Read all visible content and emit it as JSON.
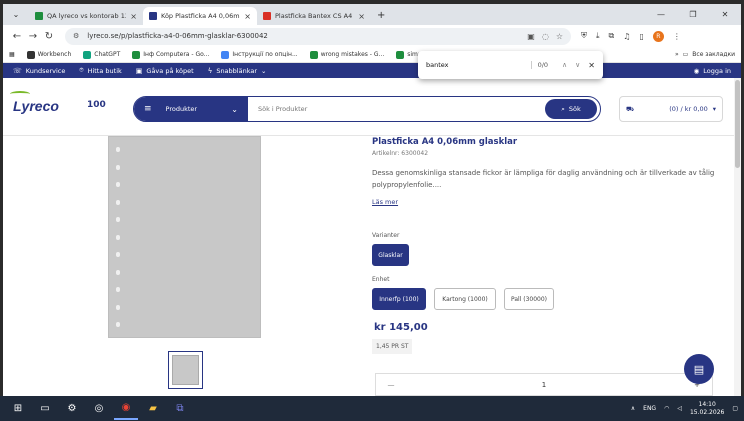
{
  "browser": {
    "tabs": [
      {
        "label": "QA lyreco vs kontorab 1388.xlsx",
        "favicon_color": "#1e8e3e",
        "active": false
      },
      {
        "label": "Köp Plastficka A4 0,06mm glasklar",
        "favicon_color": "#283583",
        "active": true
      },
      {
        "label": "Plastficka Bantex CS A4 0,06mm",
        "favicon_color": "#d93025",
        "active": false
      }
    ],
    "url": "lyreco.se/p/plastficka-a4-0-06mm-glasklar-6300042",
    "bookmarks": [
      {
        "label": "Workbench",
        "color": "#333333"
      },
      {
        "label": "ChatGPT",
        "color": "#10a37f"
      },
      {
        "label": "Інф Computera - Go...",
        "color": "#1e8e3e"
      },
      {
        "label": "Інструкції по опцін...",
        "color": "#4285f4"
      },
      {
        "label": "wrong mistakes - G...",
        "color": "#1e8e3e"
      },
      {
        "label": "simpa...",
        "color": "#1e8e3e"
      }
    ],
    "bookmarks_folder": "Все закладки",
    "profile_initial": "R"
  },
  "find_bar": {
    "query": "bantex",
    "count": "0/0"
  },
  "site": {
    "topbar": {
      "items": [
        "Kundservice",
        "Hitta butik",
        "Gåva på köpet",
        "Snabblänkar"
      ],
      "login": "Logga in"
    },
    "logo": "Lyreco",
    "anniversary": "100",
    "products_button": "Produkter",
    "search_placeholder": "Sök i Produkter",
    "search_button": "Sök",
    "cart": "(0) / kr 0,00"
  },
  "product": {
    "title": "Plastficka A4 0,06mm glasklar",
    "article_no": "Artikelnr: 6300042",
    "description": "Dessa genomskinliga stansade fickor är lämpliga för daglig användning och är tillverkade av tålig polypropylenfolie....",
    "read_more": "Läs mer",
    "variant_label": "Varianter",
    "variants": [
      "Glasklar"
    ],
    "unit_label": "Enhet",
    "units": [
      "Innerfp (100)",
      "Kartong (1000)",
      "Pall (30000)"
    ],
    "price": "kr 145,00",
    "price_per_unit": "1,45 PR ST",
    "quantity": "1",
    "qty_minus": "—",
    "qty_plus": "+"
  },
  "taskbar": {
    "language": "ENG",
    "time": "14:10",
    "date": "15.02.2026"
  },
  "colors": {
    "brand": "#283583",
    "accent": "#7ab929"
  }
}
